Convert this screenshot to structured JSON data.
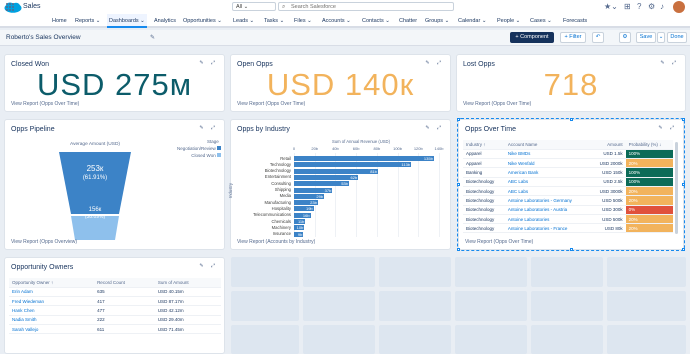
{
  "header": {
    "search_scope": "All",
    "search_placeholder": "Search Salesforce",
    "icons": [
      "favorites-icon",
      "add-icon",
      "help-icon",
      "setup-icon",
      "notifications-icon"
    ]
  },
  "nav": {
    "app_name": "Sales",
    "items": [
      {
        "label": "Home",
        "active": false
      },
      {
        "label": "Reports ⌄",
        "active": false
      },
      {
        "label": "Dashboards ⌄",
        "active": true
      },
      {
        "label": "Analytics",
        "active": false
      },
      {
        "label": "Opportunities ⌄",
        "active": false
      },
      {
        "label": "Leads ⌄",
        "active": false
      },
      {
        "label": "Tasks ⌄",
        "active": false
      },
      {
        "label": "Files ⌄",
        "active": false
      },
      {
        "label": "Accounts ⌄",
        "active": false
      },
      {
        "label": "Contacts ⌄",
        "active": false
      },
      {
        "label": "Chatter",
        "active": false
      },
      {
        "label": "Groups ⌄",
        "active": false
      },
      {
        "label": "Calendar ⌄",
        "active": false
      },
      {
        "label": "People ⌄",
        "active": false
      },
      {
        "label": "Cases ⌄",
        "active": false
      },
      {
        "label": "Forecasts",
        "active": false
      }
    ]
  },
  "dashboard": {
    "title": "Roberto's Sales Overview",
    "add_component": "+ Component",
    "filter": "+ Filter",
    "undo": "↶",
    "settings": "⚙",
    "save": "Save",
    "save_menu": "⌄",
    "done": "Done"
  },
  "cards": {
    "closed_won": {
      "title": "Closed Won",
      "value": "USD 275м",
      "footer": "View Report (Opps Over Time)",
      "color": "#0c5c6a"
    },
    "open_opps": {
      "title": "Open Opps",
      "value": "USD 140к",
      "footer": "View Report (Opps Over Time)",
      "color": "#f2b35c"
    },
    "lost_opps": {
      "title": "Lost Opps",
      "value": "718",
      "footer": "View Report (Opps Over Time)",
      "color": "#f2b35c"
    },
    "pipeline": {
      "title": "Opps Pipeline",
      "subtitle": "Average Amount (USD)",
      "legend_title": "Stage",
      "legend": [
        "Negotiation/Review",
        "Closed Won"
      ],
      "top_value": "253к",
      "top_pct": "(61.91%)",
      "bottom_value": "156к",
      "bottom_pct": "(38.09%)",
      "footer": "View Report (Opps Overview)"
    },
    "by_industry": {
      "title": "Opps by Industry",
      "x_title": "Sum of Annual Revenue (USD)",
      "y_title": "Industry",
      "footer": "View Report (Accounts by Industry)"
    },
    "over_time": {
      "title": "Opps Over Time",
      "columns": [
        "Industry ↑",
        "Account Name",
        "Amount",
        "Probability (%) ↓"
      ],
      "footer": "View Report (Opps Over Time)"
    },
    "owners": {
      "title": "Opportunity Owners",
      "columns": [
        "Opportunity Owner ↑",
        "Record Count",
        "Sum of Amount"
      ]
    }
  },
  "chart_data": {
    "type": "bar",
    "title": "",
    "xlabel": "Sum of Annual Revenue (USD)",
    "ylabel": "Industry",
    "x_ticks": [
      "0",
      "20b",
      "40b",
      "60b",
      "80b",
      "100b",
      "120b",
      "140b"
    ],
    "xlim": [
      0,
      140
    ],
    "categories": [
      "Retail",
      "Technology",
      "Biotechnology",
      "Entertainment",
      "Consulting",
      "Shipping",
      "Media",
      "Manufacturing",
      "Hospitality",
      "Telecommunications",
      "Chemicals",
      "Machinery",
      "Insurance"
    ],
    "values": [
      135,
      113,
      81,
      62,
      53,
      37,
      29,
      23,
      19,
      16,
      11,
      10,
      9
    ],
    "labels": [
      "135b",
      "113b",
      "81b",
      "62b",
      "53b",
      "37b",
      "29b",
      "23b",
      "19b",
      "16b",
      "11b",
      "10b",
      "9b"
    ]
  },
  "over_time_rows": [
    {
      "industry": "Apparel",
      "account": "Nike BMDs",
      "amount": "USD 1.5k",
      "prob": "100%",
      "color": "#0c6b58"
    },
    {
      "industry": "Apparel",
      "account": "Nike Wenfald",
      "amount": "USD 2000k",
      "prob": "20%",
      "color": "#f2b35c"
    },
    {
      "industry": "Banking",
      "account": "American Bank",
      "amount": "USD 150k",
      "prob": "100%",
      "color": "#0c6b58"
    },
    {
      "industry": "Biotechnology",
      "account": "ABC Labs",
      "amount": "USD 2.5k",
      "prob": "100%",
      "color": "#0c6b58"
    },
    {
      "industry": "Biotechnology",
      "account": "ABC Labs",
      "amount": "USD 3000k",
      "prob": "20%",
      "color": "#f2b35c"
    },
    {
      "industry": "Biotechnology",
      "account": "Antoine Laboratories - Germany",
      "amount": "USD 500k",
      "prob": "20%",
      "color": "#f2b35c"
    },
    {
      "industry": "Biotechnology",
      "account": "Antoine Laboratories - Austria",
      "amount": "USD 300k",
      "prob": "0%",
      "color": "#e0513c"
    },
    {
      "industry": "Biotechnology",
      "account": "Antoine Laboratories",
      "amount": "USD 500k",
      "prob": "20%",
      "color": "#f2b35c"
    },
    {
      "industry": "Biotechnology",
      "account": "Antoine Laboratories - France",
      "amount": "USD 80k",
      "prob": "20%",
      "color": "#f2b35c"
    }
  ],
  "owner_rows": [
    {
      "owner": "Erin Adam",
      "count": "635",
      "amount": "USD 40.15m"
    },
    {
      "owner": "Fred Wiedeman",
      "count": "417",
      "amount": "USD 87.17m"
    },
    {
      "owner": "Hank Chen",
      "count": "477",
      "amount": "USD 42.12m"
    },
    {
      "owner": "Nadia Smith",
      "count": "222",
      "amount": "USD 29.40m"
    },
    {
      "owner": "Sarah Vallejo",
      "count": "611",
      "amount": "USD 71.45m"
    }
  ]
}
